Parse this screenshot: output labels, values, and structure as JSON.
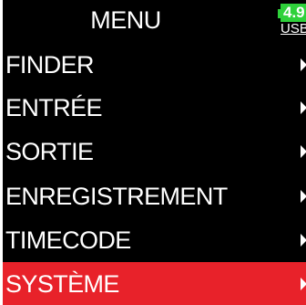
{
  "header": {
    "title": "MENU",
    "battery": {
      "level_text": "4.9",
      "source_text": "USB",
      "color": "#2fd13b"
    }
  },
  "menu": {
    "items": [
      {
        "label": "FINDER",
        "icon": "chevron-right-icon",
        "selected": false
      },
      {
        "label": "ENTRÉE",
        "icon": "chevron-right-icon",
        "selected": false
      },
      {
        "label": "SORTIE",
        "icon": "chevron-right-icon",
        "selected": false
      },
      {
        "label": "ENREGISTREMENT",
        "icon": "chevron-right-icon",
        "selected": false
      },
      {
        "label": "TIMECODE",
        "icon": "chevron-right-icon",
        "selected": false
      },
      {
        "label": "SYSTÈME",
        "icon": "chevron-right-icon",
        "selected": true
      }
    ],
    "selected_color": "#e8222a"
  }
}
